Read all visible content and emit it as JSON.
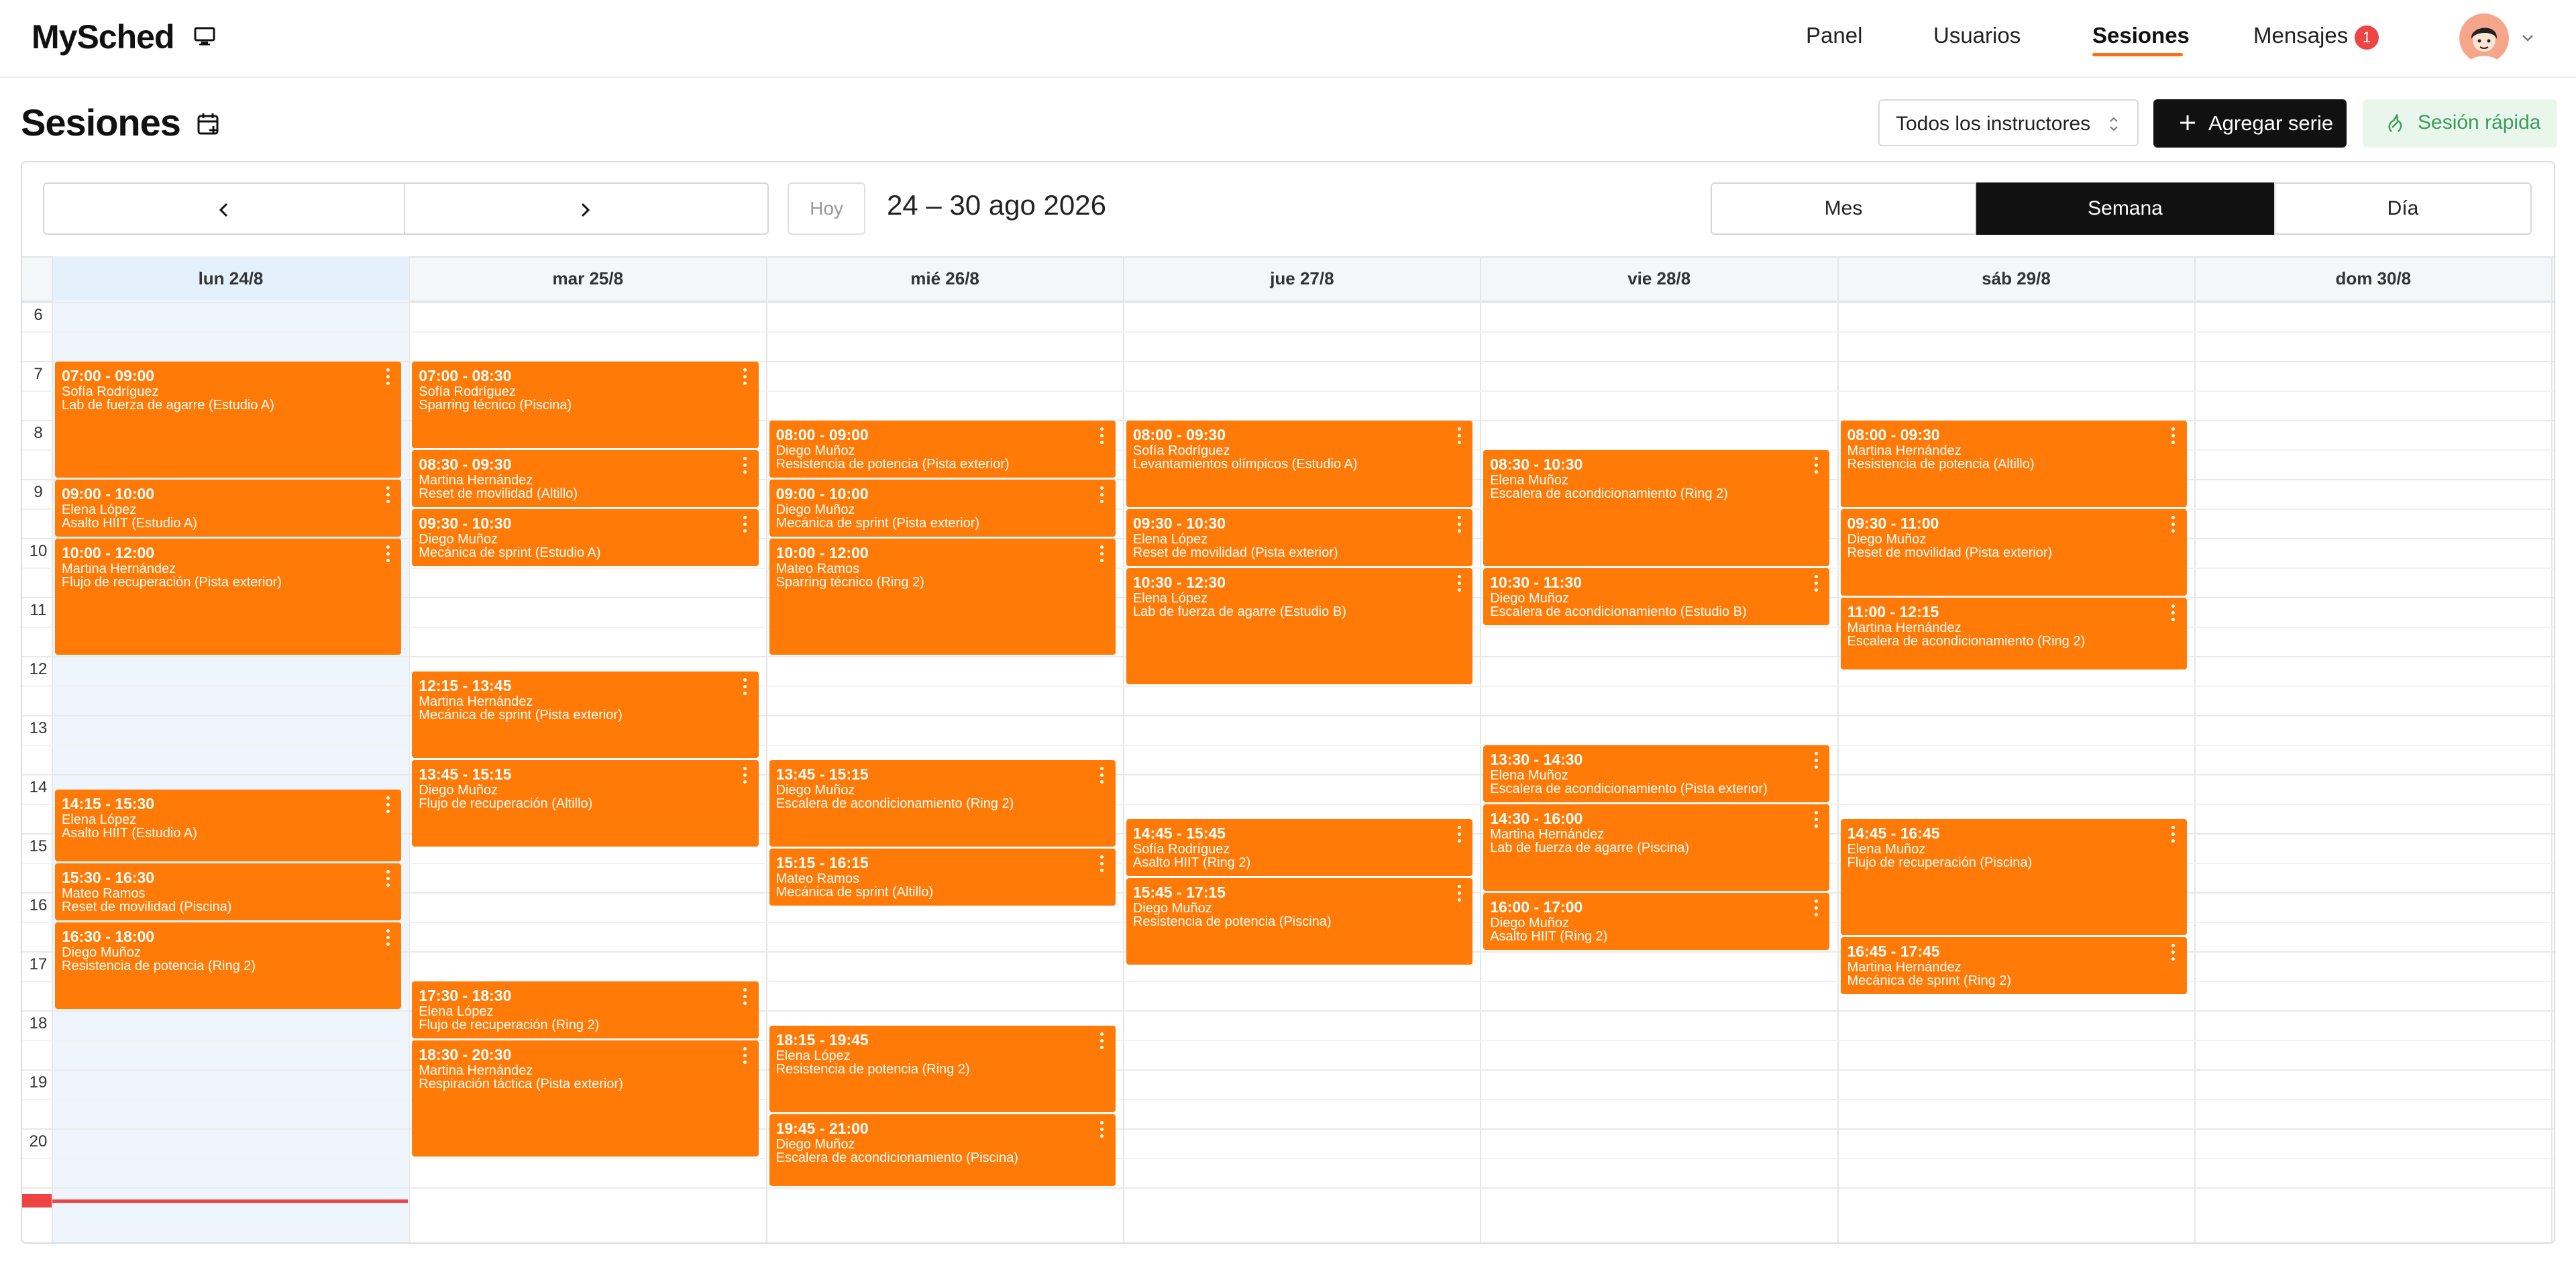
{
  "app": {
    "brand": "MySched",
    "brand_icon": "monitor-icon"
  },
  "nav": {
    "items": [
      {
        "label": "Panel",
        "active": false
      },
      {
        "label": "Usuarios",
        "active": false
      },
      {
        "label": "Sesiones",
        "active": true
      },
      {
        "label": "Mensajes",
        "active": false,
        "badge": "1"
      }
    ]
  },
  "user": {
    "avatar_icon": "user-avatar",
    "menu_icon": "chevron-down-icon"
  },
  "page": {
    "title": "Sesiones",
    "title_icon": "calendar-plus-icon"
  },
  "toolbar": {
    "instructor_select": "Todos los instructores",
    "add_series": "Agregar serie",
    "quick_session": "Sesión rápida"
  },
  "calendar": {
    "today_label": "Hoy",
    "range": "24 – 30 ago 2026",
    "views": [
      {
        "label": "Mes",
        "active": false
      },
      {
        "label": "Semana",
        "active": true
      },
      {
        "label": "Día",
        "active": false
      }
    ],
    "days": [
      "lun 24/8",
      "mar 25/8",
      "mié 26/8",
      "jue 27/8",
      "vie 28/8",
      "sáb 29/8",
      "dom 30/8"
    ],
    "today_index": 0,
    "hours": [
      "6",
      "7",
      "8",
      "9",
      "10",
      "11",
      "12",
      "13",
      "14",
      "15",
      "16",
      "17",
      "18",
      "19",
      "20"
    ],
    "event_color": "#ff7a06",
    "now_line_color": "#ef4444",
    "events": [
      {
        "day": 0,
        "start": "07:00",
        "end": "09:00",
        "time": "07:00 - 09:00",
        "person": "Sofía Rodríguez",
        "class": "Lab de fuerza de agarre (Estudio A)"
      },
      {
        "day": 0,
        "start": "09:00",
        "end": "10:00",
        "time": "09:00 - 10:00",
        "person": "Elena López",
        "class": "Asalto HIIT (Estudio A)"
      },
      {
        "day": 0,
        "start": "10:00",
        "end": "12:00",
        "time": "10:00 - 12:00",
        "person": "Martina Hernández",
        "class": "Flujo de recuperación (Pista exterior)"
      },
      {
        "day": 0,
        "start": "14:15",
        "end": "15:30",
        "time": "14:15 - 15:30",
        "person": "Elena López",
        "class": "Asalto HIIT (Estudio A)"
      },
      {
        "day": 0,
        "start": "15:30",
        "end": "16:30",
        "time": "15:30 - 16:30",
        "person": "Mateo Ramos",
        "class": "Reset de movilidad (Piscina)"
      },
      {
        "day": 0,
        "start": "16:30",
        "end": "18:00",
        "time": "16:30 - 18:00",
        "person": "Diego Muñoz",
        "class": "Resistencia de potencia (Ring 2)"
      },
      {
        "day": 1,
        "start": "07:00",
        "end": "08:30",
        "time": "07:00 - 08:30",
        "person": "Sofía Rodríguez",
        "class": "Sparring técnico (Piscina)"
      },
      {
        "day": 1,
        "start": "08:30",
        "end": "09:30",
        "time": "08:30 - 09:30",
        "person": "Martina Hernández",
        "class": "Reset de movilidad (Altillo)"
      },
      {
        "day": 1,
        "start": "09:30",
        "end": "10:30",
        "time": "09:30 - 10:30",
        "person": "Diego Muñoz",
        "class": "Mecánica de sprint (Estudio A)"
      },
      {
        "day": 1,
        "start": "12:15",
        "end": "13:45",
        "time": "12:15 - 13:45",
        "person": "Martina Hernández",
        "class": "Mecánica de sprint (Pista exterior)"
      },
      {
        "day": 1,
        "start": "13:45",
        "end": "15:15",
        "time": "13:45 - 15:15",
        "person": "Diego Muñoz",
        "class": "Flujo de recuperación (Altillo)"
      },
      {
        "day": 1,
        "start": "17:30",
        "end": "18:30",
        "time": "17:30 - 18:30",
        "person": "Elena López",
        "class": "Flujo de recuperación (Ring 2)"
      },
      {
        "day": 1,
        "start": "18:30",
        "end": "20:30",
        "time": "18:30 - 20:30",
        "person": "Martina Hernández",
        "class": "Respiración táctica (Pista exterior)"
      },
      {
        "day": 2,
        "start": "08:00",
        "end": "09:00",
        "time": "08:00 - 09:00",
        "person": "Diego Muñoz",
        "class": "Resistencia de potencia (Pista exterior)"
      },
      {
        "day": 2,
        "start": "09:00",
        "end": "10:00",
        "time": "09:00 - 10:00",
        "person": "Diego Muñoz",
        "class": "Mecánica de sprint (Pista exterior)"
      },
      {
        "day": 2,
        "start": "10:00",
        "end": "12:00",
        "time": "10:00 - 12:00",
        "person": "Mateo Ramos",
        "class": "Sparring técnico (Ring 2)"
      },
      {
        "day": 2,
        "start": "13:45",
        "end": "15:15",
        "time": "13:45 - 15:15",
        "person": "Diego Muñoz",
        "class": "Escalera de acondicionamiento (Ring 2)"
      },
      {
        "day": 2,
        "start": "15:15",
        "end": "16:15",
        "time": "15:15 - 16:15",
        "person": "Mateo Ramos",
        "class": "Mecánica de sprint (Altillo)"
      },
      {
        "day": 2,
        "start": "18:15",
        "end": "19:45",
        "time": "18:15 - 19:45",
        "person": "Elena López",
        "class": "Resistencia de potencia (Ring 2)"
      },
      {
        "day": 2,
        "start": "19:45",
        "end": "21:00",
        "time": "19:45 - 21:00",
        "person": "Diego Muñoz",
        "class": "Escalera de acondicionamiento (Piscina)"
      },
      {
        "day": 3,
        "start": "08:00",
        "end": "09:30",
        "time": "08:00 - 09:30",
        "person": "Sofía Rodríguez",
        "class": "Levantamientos olímpicos (Estudio A)"
      },
      {
        "day": 3,
        "start": "09:30",
        "end": "10:30",
        "time": "09:30 - 10:30",
        "person": "Elena López",
        "class": "Reset de movilidad (Pista exterior)"
      },
      {
        "day": 3,
        "start": "10:30",
        "end": "12:30",
        "time": "10:30 - 12:30",
        "person": "Elena López",
        "class": "Lab de fuerza de agarre (Estudio B)"
      },
      {
        "day": 3,
        "start": "14:45",
        "end": "15:45",
        "time": "14:45 - 15:45",
        "person": "Sofía Rodríguez",
        "class": "Asalto HIIT (Ring 2)"
      },
      {
        "day": 3,
        "start": "15:45",
        "end": "17:15",
        "time": "15:45 - 17:15",
        "person": "Diego Muñoz",
        "class": "Resistencia de potencia (Piscina)"
      },
      {
        "day": 4,
        "start": "08:30",
        "end": "10:30",
        "time": "08:30 - 10:30",
        "person": "Elena Muñoz",
        "class": "Escalera de acondicionamiento (Ring 2)"
      },
      {
        "day": 4,
        "start": "10:30",
        "end": "11:30",
        "time": "10:30 - 11:30",
        "person": "Diego Muñoz",
        "class": "Escalera de acondicionamiento (Estudio B)"
      },
      {
        "day": 4,
        "start": "13:30",
        "end": "14:30",
        "time": "13:30 - 14:30",
        "person": "Elena Muñoz",
        "class": "Escalera de acondicionamiento (Pista exterior)"
      },
      {
        "day": 4,
        "start": "14:30",
        "end": "16:00",
        "time": "14:30 - 16:00",
        "person": "Martina Hernández",
        "class": "Lab de fuerza de agarre (Piscina)"
      },
      {
        "day": 4,
        "start": "16:00",
        "end": "17:00",
        "time": "16:00 - 17:00",
        "person": "Diego Muñoz",
        "class": "Asalto HIIT (Ring 2)"
      },
      {
        "day": 5,
        "start": "08:00",
        "end": "09:30",
        "time": "08:00 - 09:30",
        "person": "Martina Hernández",
        "class": "Resistencia de potencia (Altillo)"
      },
      {
        "day": 5,
        "start": "09:30",
        "end": "11:00",
        "time": "09:30 - 11:00",
        "person": "Diego Muñoz",
        "class": "Reset de movilidad (Pista exterior)"
      },
      {
        "day": 5,
        "start": "11:00",
        "end": "12:15",
        "time": "11:00 - 12:15",
        "person": "Martina Hernández",
        "class": "Escalera de acondicionamiento (Ring 2)"
      },
      {
        "day": 5,
        "start": "14:45",
        "end": "16:45",
        "time": "14:45 - 16:45",
        "person": "Elena Muñoz",
        "class": "Flujo de recuperación (Piscina)"
      },
      {
        "day": 5,
        "start": "16:45",
        "end": "17:45",
        "time": "16:45 - 17:45",
        "person": "Martina Hernández",
        "class": "Mecánica de sprint (Ring 2)"
      }
    ]
  }
}
